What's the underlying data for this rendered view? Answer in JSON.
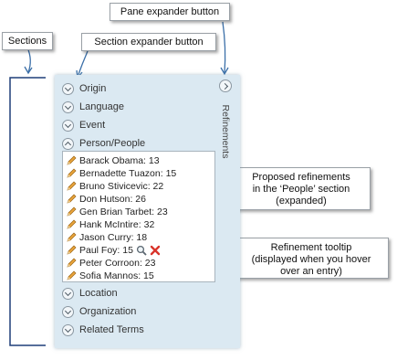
{
  "callouts": {
    "pane_expander": "Pane expander button",
    "sections": "Sections",
    "section_expander": "Section expander button",
    "proposed": [
      "Proposed refinements",
      "in the ‘People’ section",
      "(expanded)"
    ],
    "tooltip": [
      "Refinement tooltip",
      "(displayed when you hover",
      "over an entry)"
    ]
  },
  "pane": {
    "title": "Refinements"
  },
  "sections": [
    {
      "label": "Origin",
      "state": "collapsed"
    },
    {
      "label": "Language",
      "state": "collapsed"
    },
    {
      "label": "Event",
      "state": "collapsed"
    },
    {
      "label": "Person/People",
      "state": "expanded"
    },
    {
      "label": "Location",
      "state": "collapsed"
    },
    {
      "label": "Organization",
      "state": "collapsed"
    },
    {
      "label": "Related Terms",
      "state": "collapsed"
    }
  ],
  "people": [
    {
      "text": "Barack Obama: 13"
    },
    {
      "text": "Bernadette Tuazon: 15"
    },
    {
      "text": "Bruno Stivicevic: 22"
    },
    {
      "text": "Don Hutson: 26"
    },
    {
      "text": "Gen Brian Tarbet: 23"
    },
    {
      "text": "Hank McIntire: 32"
    },
    {
      "text": "Jason Curry: 18"
    },
    {
      "text": "Paul Foy: 15"
    },
    {
      "text": "Peter Corroon: 23"
    },
    {
      "text": "Sofia Mannos: 15"
    }
  ],
  "icons": {
    "entry": "pencil-icon",
    "hover_actions": [
      "search-icon",
      "remove-icon"
    ],
    "pane_expander": "chevron-right-icon",
    "section_expander": "chevron-down-icon"
  },
  "colors": {
    "panel_bg": "#dbe9f2",
    "arrow": "#3b6fa8",
    "bracket": "#1f3e78",
    "remove": "#d9342b"
  }
}
